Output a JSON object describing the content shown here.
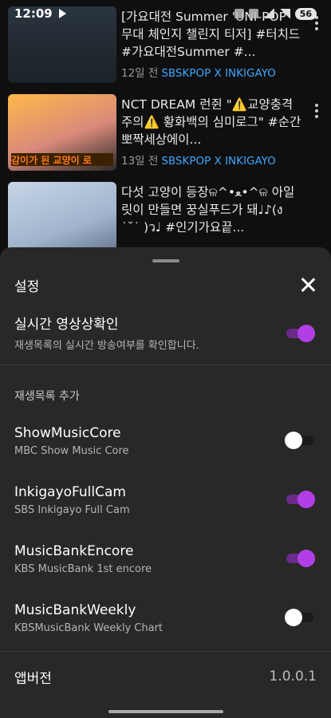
{
  "status_bar": {
    "time": "12:09",
    "battery": "56"
  },
  "feed": [
    {
      "title": "[가요대전 Summer 'UNI-POP' 무대 체인지 챌린지 티저] #터치드 #가요대전Summer #...",
      "age": "12일 전",
      "channel": "SBSKPOP X INKIGAYO"
    },
    {
      "title": "NCT DREAM 런쥔 \"⚠️교양충격주의⚠️ 황화백의 심미로그\" #순간뽀짝세상에이...",
      "age": "13일 전",
      "channel": "SBSKPOP X INKIGAYO",
      "thumb_caption": "감이가 된 교양이 로"
    },
    {
      "title": "다섯 고양이 등장ଳ^•ﻌ•^ଳ 아일릿이 만들면 꿍실푸드가 돼♩♪(ง ˙˘˙ )ว♩ #인기가요끝...",
      "age": "",
      "channel": ""
    }
  ],
  "sheet": {
    "title": "설정",
    "realtime": {
      "label": "실시간 영상상확인",
      "sub": "재생목록의 실시간 방송여부를 확인합니다.",
      "on": true
    },
    "section_header": "재생목록 추가",
    "playlists": [
      {
        "label": "ShowMusicCore",
        "sub": "MBC Show Music Core",
        "on": false
      },
      {
        "label": "InkigayoFullCam",
        "sub": "SBS Inkigayo Full Cam",
        "on": true
      },
      {
        "label": "MusicBankEncore",
        "sub": "KBS MusicBank 1st encore",
        "on": true
      },
      {
        "label": "MusicBankWeekly",
        "sub": "KBSMusicBank Weekly Chart",
        "on": false
      }
    ],
    "version_label": "앱버전",
    "version_value": "1.0.0.1"
  },
  "colors": {
    "toggle_on": "#b23fe6",
    "toggle_off": "#ffffff",
    "channel_link": "#3ea6ff",
    "sheet_bg": "#282828"
  }
}
